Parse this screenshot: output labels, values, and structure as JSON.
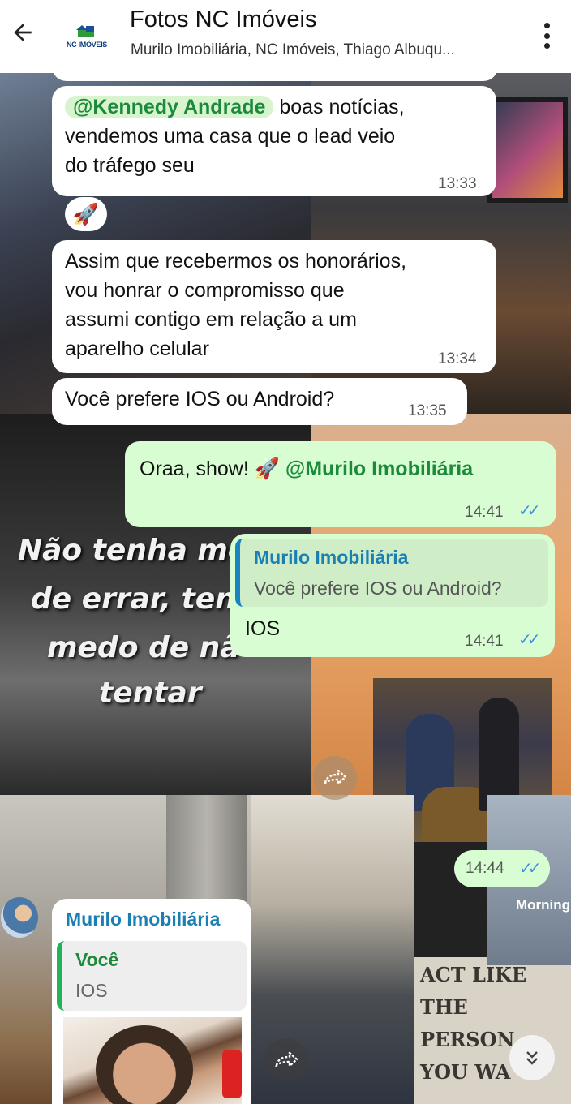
{
  "header": {
    "title": "Fotos NC Imóveis",
    "subtitle": "Murilo Imobiliária, NC Imóveis, Thiago Albuqu...",
    "logo_text": "NC IMÓVEIS"
  },
  "messages": {
    "m1": {
      "mention": "@Kennedy Andrade",
      "text_a": " boas notícias,",
      "text_b": "vendemos uma casa que o lead veio",
      "text_c": "do tráfego seu",
      "time": "13:33",
      "reaction": "🚀"
    },
    "m2": {
      "line1": "Assim que recebermos os honorários,",
      "line2": "vou honrar o compromisso que",
      "line3": "assumi contigo em relação a um",
      "line4": "aparelho celular",
      "time": "13:34"
    },
    "m3": {
      "text": "Você prefere IOS ou Android?",
      "time": "13:35"
    },
    "m4": {
      "text": "Oraa, show! 🚀 ",
      "mention": "@Murilo Imobiliária",
      "time": "14:41"
    },
    "m5": {
      "quote_author": "Murilo Imobiliária",
      "quote_text": "Você prefere IOS ou Android?",
      "text": "IOS",
      "time": "14:41"
    },
    "m6": {
      "time": "14:44"
    },
    "m7": {
      "author": "Murilo Imobiliária",
      "quote_author": "Você",
      "quote_text": "IOS"
    }
  },
  "wallpaper": {
    "poster_lines": [
      "Não tenha me",
      "de errar, ten",
      "medo de nã",
      "tentar"
    ],
    "act_lines": [
      "ACT LIKE",
      "THE",
      "PERSON",
      "YOU WA"
    ],
    "morning": "Morning"
  },
  "colors": {
    "header_bg": "#ffffff",
    "incoming_bubble": "#ffffff",
    "outgoing_bubble": "#d9fdd3",
    "mention_green": "#1b8a3a",
    "author_blue": "#1a7fb5",
    "tick_blue": "#3d8ee0"
  },
  "icons": {
    "back": "arrow-left-icon",
    "menu": "more-vertical-icon",
    "forward": "forward-icon",
    "scroll_down": "double-chevron-down-icon",
    "double_check": "double-check-icon"
  }
}
